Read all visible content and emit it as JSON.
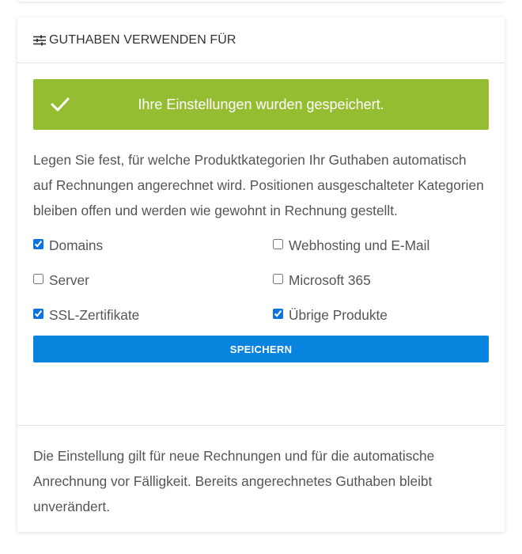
{
  "header": {
    "icon": "sliders-icon",
    "title": "GUTHABEN VERWENDEN FÜR"
  },
  "alert": {
    "icon": "checkmark-icon",
    "message": "Ihre Einstellungen wurden gespeichert.",
    "color": "#95bd32"
  },
  "description": "Legen Sie fest, für welche Produktkategorien Ihr Guthaben automatisch auf Rechnungen angerechnet wird. Positionen ausgeschalteter Kategorien bleiben offen und werden wie gewohnt in Rechnung gestellt.",
  "options": [
    {
      "label": "Domains",
      "checked": true
    },
    {
      "label": "Webhosting und E-Mail",
      "checked": false
    },
    {
      "label": "Server",
      "checked": false
    },
    {
      "label": "Microsoft 365",
      "checked": false
    },
    {
      "label": "SSL-Zertifikate",
      "checked": true
    },
    {
      "label": "Übrige Produkte",
      "checked": true
    }
  ],
  "save_button": {
    "label": "SPEICHERN",
    "color": "#0883de"
  },
  "footer": "Die Einstellung gilt für neue Rechnungen und für die automatische Anrechnung vor Fälligkeit. Bereits angerechnetes Guthaben bleibt unverändert."
}
